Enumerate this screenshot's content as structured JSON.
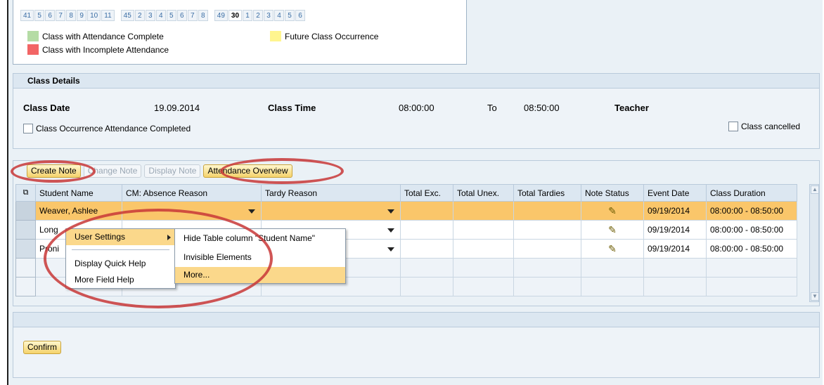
{
  "calendar": {
    "weeks": [
      {
        "label": "41",
        "style": "link"
      },
      {
        "label": "5",
        "style": "link"
      },
      {
        "label": "6",
        "style": "link"
      },
      {
        "label": "7",
        "style": "link"
      },
      {
        "label": "8",
        "style": "link"
      },
      {
        "label": "9",
        "style": "link"
      },
      {
        "label": "10",
        "style": "link"
      },
      {
        "label": "11",
        "style": "link"
      },
      {
        "label": "45",
        "style": "link",
        "gap": true
      },
      {
        "label": "2",
        "style": "link"
      },
      {
        "label": "3",
        "style": "link"
      },
      {
        "label": "4",
        "style": "link"
      },
      {
        "label": "5",
        "style": "link"
      },
      {
        "label": "6",
        "style": "link"
      },
      {
        "label": "7",
        "style": "link"
      },
      {
        "label": "8",
        "style": "link"
      },
      {
        "label": "49",
        "style": "link",
        "gap": true
      },
      {
        "label": "30",
        "style": "bold"
      },
      {
        "label": "1",
        "style": "link"
      },
      {
        "label": "2",
        "style": "link"
      },
      {
        "label": "3",
        "style": "link"
      },
      {
        "label": "4",
        "style": "link"
      },
      {
        "label": "5",
        "style": "link"
      },
      {
        "label": "6",
        "style": "link"
      }
    ],
    "legend": {
      "complete": {
        "label": "Class with Attendance Complete",
        "color": "#b5dca5"
      },
      "incomplete": {
        "label": "Class with Incomplete Attendance",
        "color": "#f26565"
      },
      "future": {
        "label": "Future Class Occurrence",
        "color": "#fff58f"
      }
    }
  },
  "class_details": {
    "title": "Class Details",
    "date_label": "Class Date",
    "date_value": "19.09.2014",
    "time_label": "Class Time",
    "time_from": "08:00:00",
    "to_label": "To",
    "time_to": "08:50:00",
    "teacher_label": "Teacher",
    "attendance_completed_label": "Class Occurrence Attendance Completed",
    "cancelled_label": "Class cancelled"
  },
  "toolbar": {
    "create_note": "Create Note",
    "change_note": "Change Note",
    "display_note": "Display Note",
    "attendance_overview": "Attendance Overview"
  },
  "table": {
    "columns": [
      "Student Name",
      "CM: Absence Reason",
      "Tardy Reason",
      "Total Exc.",
      "Total Unex.",
      "Total Tardies",
      "Note Status",
      "Event Date",
      "Class Duration"
    ],
    "rows": [
      {
        "name": "Weaver, Ashlee",
        "event_date": "09/19/2014",
        "duration": "08:00:00 - 08:50:00"
      },
      {
        "name": "Long",
        "event_date": "09/19/2014",
        "duration": "08:00:00 - 08:50:00"
      },
      {
        "name": "Proni",
        "event_date": "09/19/2014",
        "duration": "08:00:00 - 08:50:00"
      }
    ]
  },
  "context_menu": {
    "user_settings": "User Settings",
    "display_quick_help": "Display Quick Help",
    "more_field_help": "More Field Help",
    "submenu": {
      "hide_column": "Hide Table column \"Student Name\"",
      "invisible_elements": "Invisible Elements",
      "more": "More..."
    }
  },
  "footer": {
    "confirm": "Confirm"
  },
  "colors": {
    "selected_row": "#fac66a",
    "annotation": "#c83737"
  },
  "icons": {
    "note_status": "pencil-note-icon",
    "table_settings": "table-settings-icon"
  }
}
